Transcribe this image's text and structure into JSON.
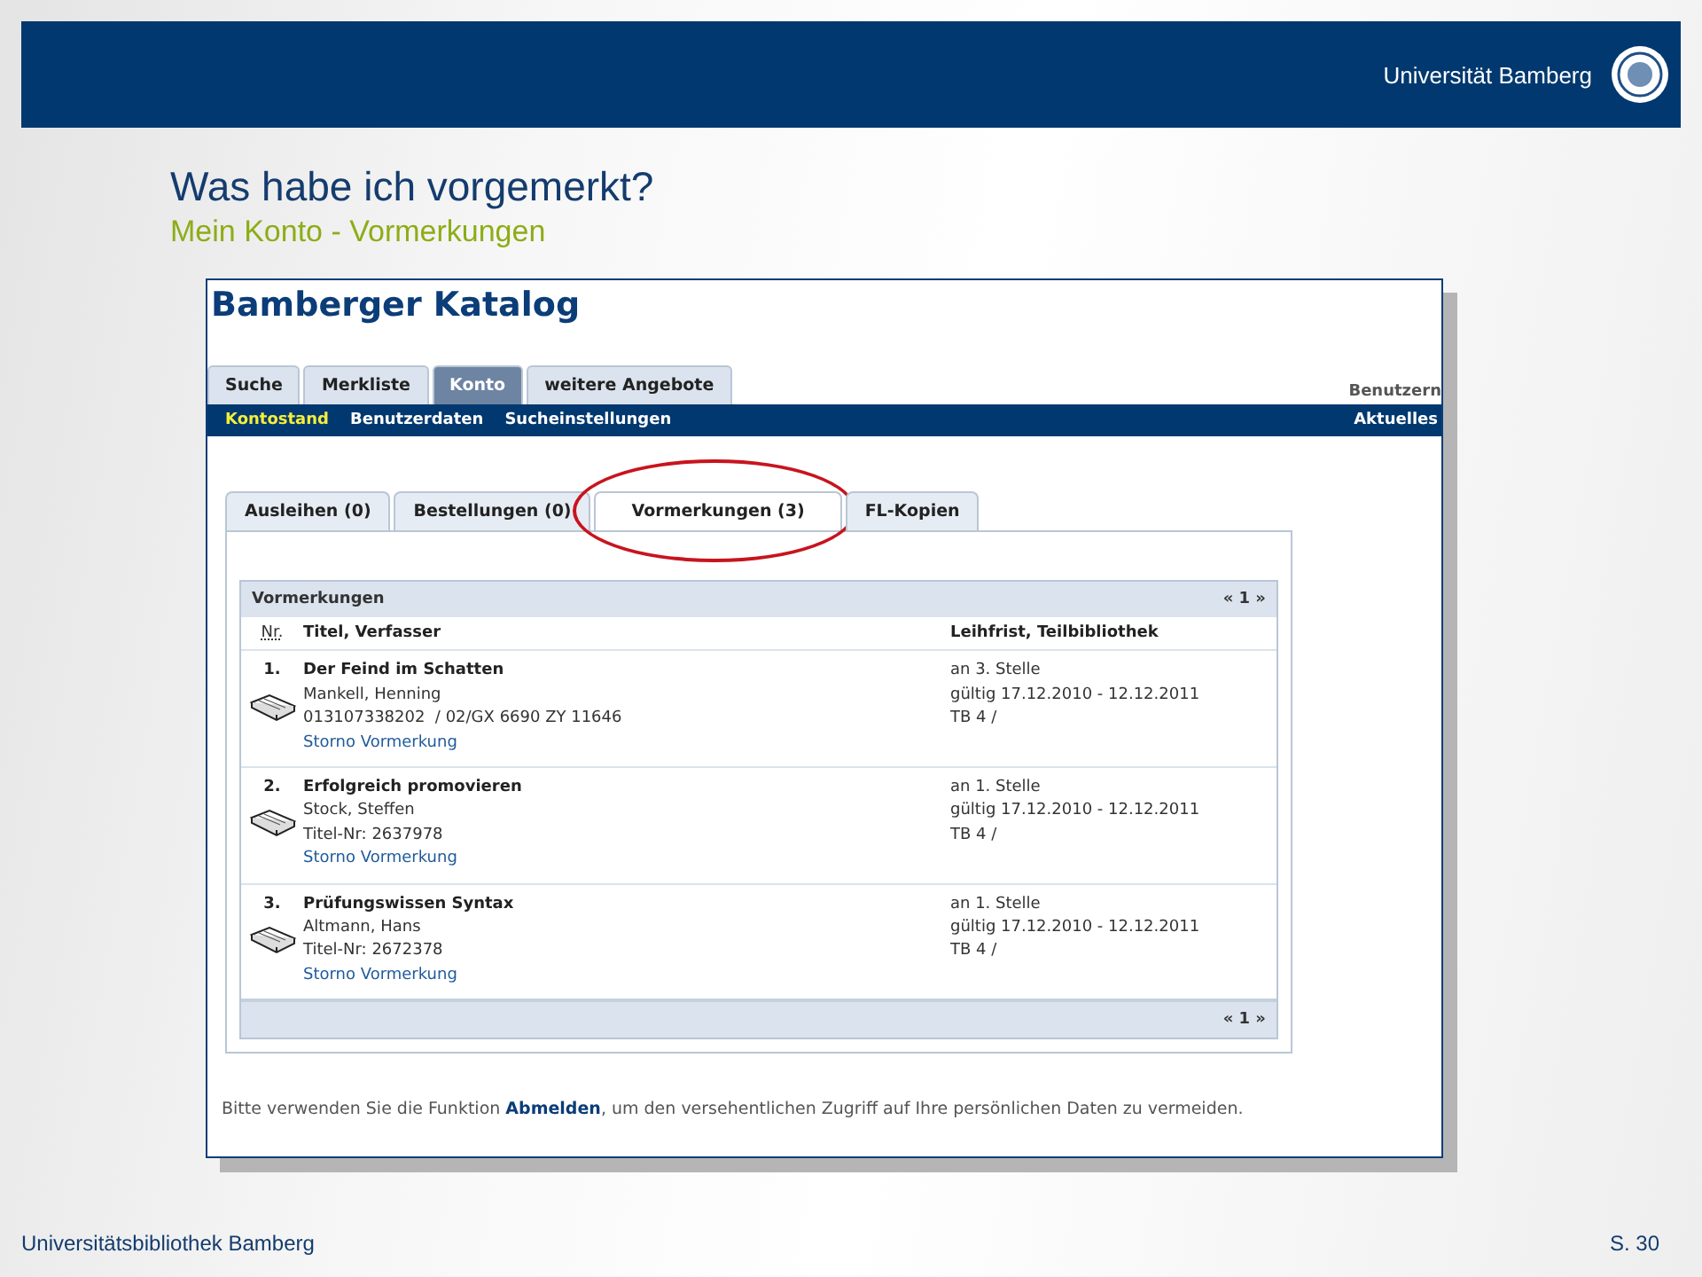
{
  "header": {
    "logo_text": "Universität Bamberg"
  },
  "title": "Was habe ich vorgemerkt?",
  "subtitle": "Mein Konto - Vormerkungen",
  "screenshot": {
    "catalog_title": "Bamberger Katalog",
    "main_tabs": [
      {
        "label": "Suche",
        "selected": false
      },
      {
        "label": "Merkliste",
        "selected": false
      },
      {
        "label": "Konto",
        "selected": true
      },
      {
        "label": "weitere Angebote",
        "selected": false
      }
    ],
    "user_label": "Benutzern",
    "subnav": [
      {
        "label": "Kontostand",
        "selected": true
      },
      {
        "label": "Benutzerdaten",
        "selected": false
      },
      {
        "label": "Sucheinstellungen",
        "selected": false
      }
    ],
    "subnav_right": "Aktuelles",
    "account_tabs": [
      {
        "label": "Ausleihen (0)",
        "selected": false
      },
      {
        "label": "Bestellungen (0)",
        "selected": false
      },
      {
        "label": "Vormerkungen (3)",
        "selected": true
      },
      {
        "label": "FL-Kopien",
        "selected": false
      }
    ],
    "panel": {
      "title": "Vormerkungen",
      "pager": "« 1 »",
      "columns": [
        "Nr.",
        "Titel, Verfasser",
        "Leihfrist, Teilbibliothek"
      ],
      "rows": [
        {
          "number": "1.",
          "title": "Der Feind im Schatten",
          "author": "Mankell, Henning",
          "id": "013107338202  / 02/GX 6690 ZY 11646",
          "action": "Storno Vormerkung",
          "position": "an 3. Stelle",
          "validity": "gültig 17.12.2010 - 12.12.2011",
          "branch": "TB 4 /"
        },
        {
          "number": "2.",
          "title": "Erfolgreich promovieren",
          "author": "Stock, Steffen",
          "id": "Titel-Nr: 2637978",
          "action": "Storno Vormerkung",
          "position": "an 1. Stelle",
          "validity": "gültig 17.12.2010 - 12.12.2011",
          "branch": "TB 4 /"
        },
        {
          "number": "3.",
          "title": "Prüfungswissen Syntax",
          "author": "Altmann, Hans",
          "id": "Titel-Nr: 2672378",
          "action": "Storno Vormerkung",
          "position": "an 1. Stelle",
          "validity": "gültig 17.12.2010 - 12.12.2011",
          "branch": "TB 4 /"
        }
      ],
      "footer_pager": "« 1 »"
    },
    "notice_before": "Bitte verwenden Sie die Funktion ",
    "notice_link": "Abmelden",
    "notice_after": ", um den versehentlichen Zugriff auf Ihre persönlichen Daten zu vermeiden."
  },
  "footer": {
    "left": "Universitätsbibliothek Bamberg",
    "right": "S. 30"
  }
}
